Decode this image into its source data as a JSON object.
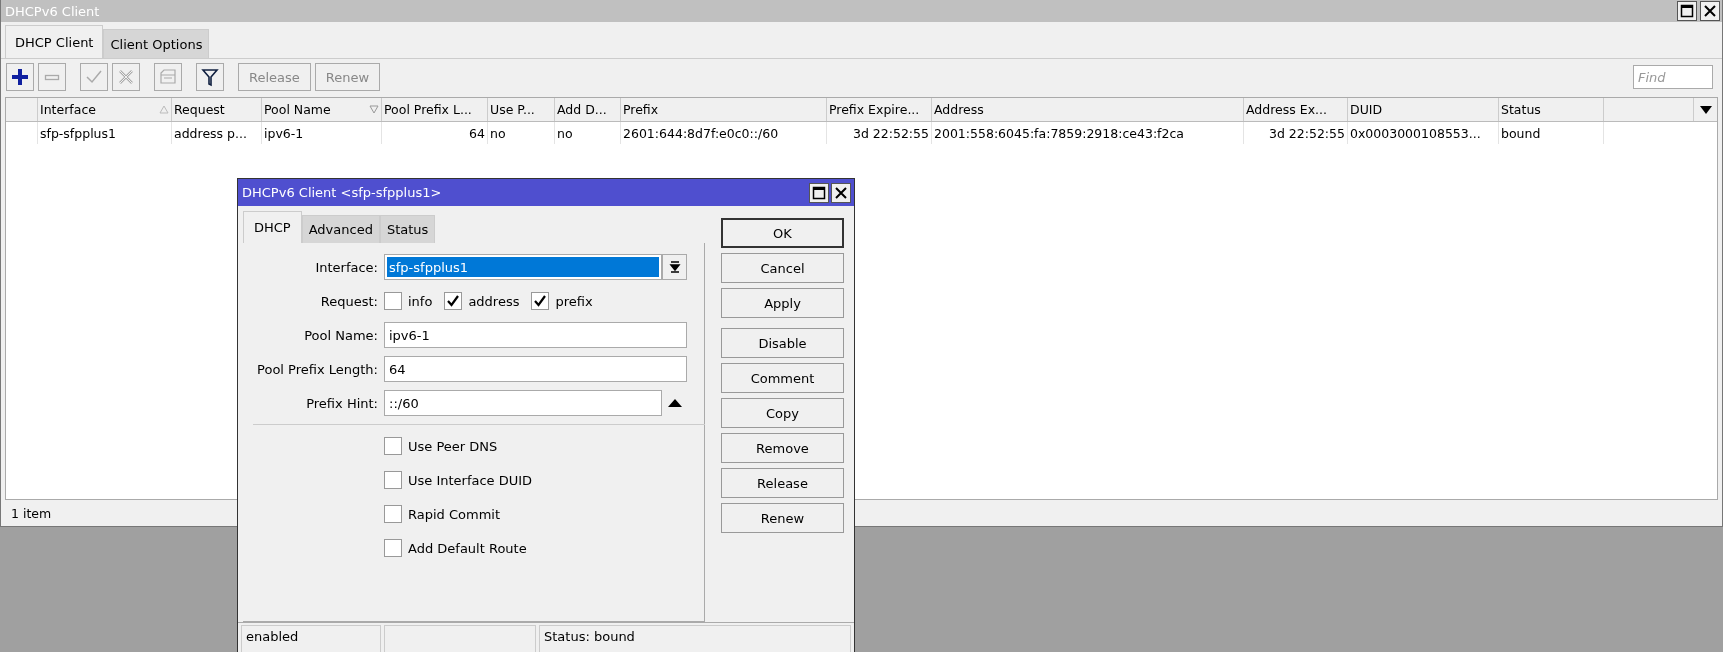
{
  "window": {
    "title": "DHCPv6 Client"
  },
  "tabs": [
    {
      "label": "DHCP Client",
      "selected": true
    },
    {
      "label": "Client Options",
      "selected": false
    }
  ],
  "toolbar": {
    "icon_buttons": [
      {
        "kind": "add",
        "disabled": false
      },
      {
        "kind": "remove",
        "disabled": true
      },
      {
        "kind": "enable",
        "disabled": true
      },
      {
        "kind": "disable",
        "disabled": true
      },
      {
        "kind": "comment",
        "disabled": true
      },
      {
        "kind": "filter",
        "disabled": false
      }
    ],
    "text_buttons": [
      {
        "label": "Release",
        "disabled": true
      },
      {
        "label": "Renew",
        "disabled": true
      }
    ],
    "find": {
      "placeholder": "Find"
    }
  },
  "table": {
    "columns": [
      {
        "label": "Interface",
        "sorted_ascending": true,
        "sorted_descending": false
      },
      {
        "label": "Request",
        "sorted_ascending": false,
        "sorted_descending": false
      },
      {
        "label": "Pool Name",
        "sorted_ascending": false,
        "sorted_descending": true
      },
      {
        "label": "Pool Prefix L...",
        "sorted_ascending": false,
        "sorted_descending": false
      },
      {
        "label": "Use P...",
        "sorted_ascending": false,
        "sorted_descending": false
      },
      {
        "label": "Add D...",
        "sorted_ascending": false,
        "sorted_descending": false
      },
      {
        "label": "Prefix",
        "sorted_ascending": false,
        "sorted_descending": false
      },
      {
        "label": "Prefix Expire...",
        "sorted_ascending": false,
        "sorted_descending": false
      },
      {
        "label": "Address",
        "sorted_ascending": false,
        "sorted_descending": false
      },
      {
        "label": "Address Ex...",
        "sorted_ascending": false,
        "sorted_descending": false
      },
      {
        "label": "DUID",
        "sorted_ascending": false,
        "sorted_descending": false
      },
      {
        "label": "Status",
        "sorted_ascending": false,
        "sorted_descending": false
      }
    ],
    "rows": [
      {
        "cells": [
          "sfp-sfpplus1",
          "address p...",
          "ipv6-1",
          "64",
          "no",
          "no",
          "2601:644:8d7f:e0c0::/60",
          "3d 22:52:55",
          "2001:558:6045:fa:7859:2918:ce43:f2ca",
          "3d 22:52:55",
          "0x0003000108553...",
          "bound"
        ]
      }
    ]
  },
  "status_bar": {
    "count": "1 item"
  },
  "dialog": {
    "title": "DHCPv6 Client <sfp-sfpplus1>",
    "tabs": [
      {
        "label": "DHCP",
        "selected": true
      },
      {
        "label": "Advanced",
        "selected": false
      },
      {
        "label": "Status",
        "selected": false
      }
    ],
    "fields": [
      {
        "kind": "select",
        "label": "Interface:",
        "value": "sfp-sfpplus1"
      },
      {
        "kind": "checks",
        "label": "Request:",
        "options": [
          {
            "label": "info",
            "checked": false
          },
          {
            "label": "address",
            "checked": true
          },
          {
            "label": "prefix",
            "checked": true
          }
        ]
      },
      {
        "kind": "text",
        "label": "Pool Name:",
        "value": "ipv6-1"
      },
      {
        "kind": "text",
        "label": "Pool Prefix Length:",
        "value": "64"
      },
      {
        "kind": "collapsible",
        "label": "Prefix Hint:",
        "value": "::/60"
      }
    ],
    "options": [
      {
        "label": "Use Peer DNS",
        "checked": false
      },
      {
        "label": "Use Interface DUID",
        "checked": false
      },
      {
        "label": "Rapid Commit",
        "checked": false
      },
      {
        "label": "Add Default Route",
        "checked": false
      }
    ],
    "button_groups": [
      [
        {
          "label": "OK",
          "default": true
        },
        {
          "label": "Cancel",
          "default": false
        },
        {
          "label": "Apply",
          "default": false
        }
      ],
      [
        {
          "label": "Disable",
          "default": false
        },
        {
          "label": "Comment",
          "default": false
        },
        {
          "label": "Copy",
          "default": false
        },
        {
          "label": "Remove",
          "default": false
        },
        {
          "label": "Release",
          "default": false
        },
        {
          "label": "Renew",
          "default": false
        }
      ]
    ],
    "status_bar": {
      "state": "enabled",
      "status": "Status: bound"
    }
  }
}
